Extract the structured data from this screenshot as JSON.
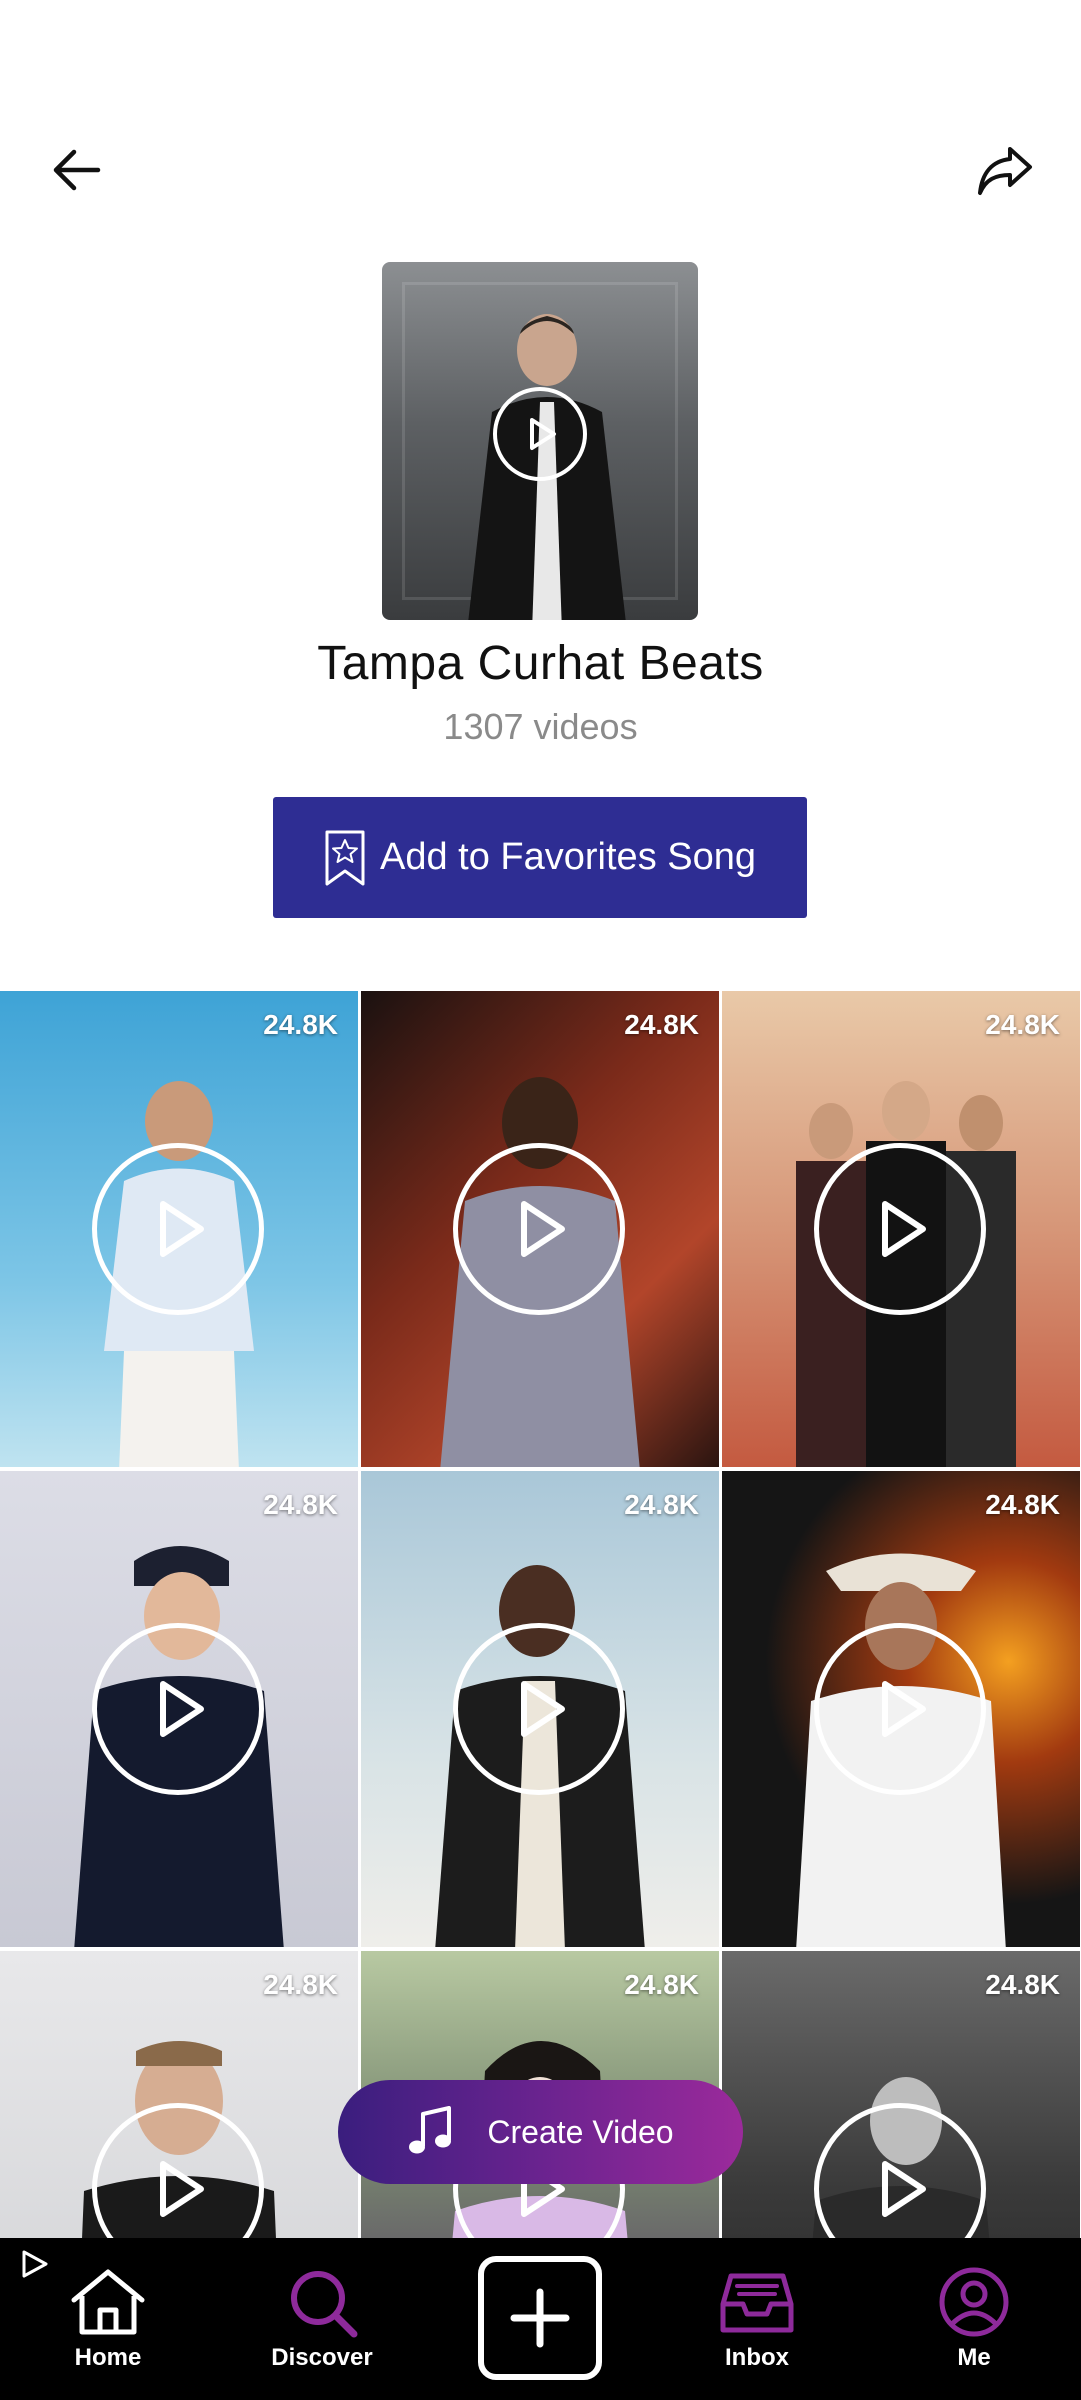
{
  "header": {
    "back_icon": "arrow-left-icon",
    "share_icon": "share-icon"
  },
  "song": {
    "title": "Tampa Curhat Beats",
    "video_count": "1307 videos",
    "cover_play_icon": "play-icon"
  },
  "favorites": {
    "label": "Add to Favorites Song",
    "icon": "bookmark-star-icon",
    "color": "#2e2d93"
  },
  "videos": [
    {
      "views": "24.8K"
    },
    {
      "views": "24.8K"
    },
    {
      "views": "24.8K"
    },
    {
      "views": "24.8K"
    },
    {
      "views": "24.8K"
    },
    {
      "views": "24.8K"
    },
    {
      "views": "24.8K"
    },
    {
      "views": "24.8K"
    },
    {
      "views": "24.8K"
    }
  ],
  "create_video": {
    "label": "Create Video",
    "icon": "music-note-icon"
  },
  "nav": {
    "home": "Home",
    "discover": "Discover",
    "inbox": "Inbox",
    "me": "Me",
    "accent": "#8e2a9b"
  }
}
